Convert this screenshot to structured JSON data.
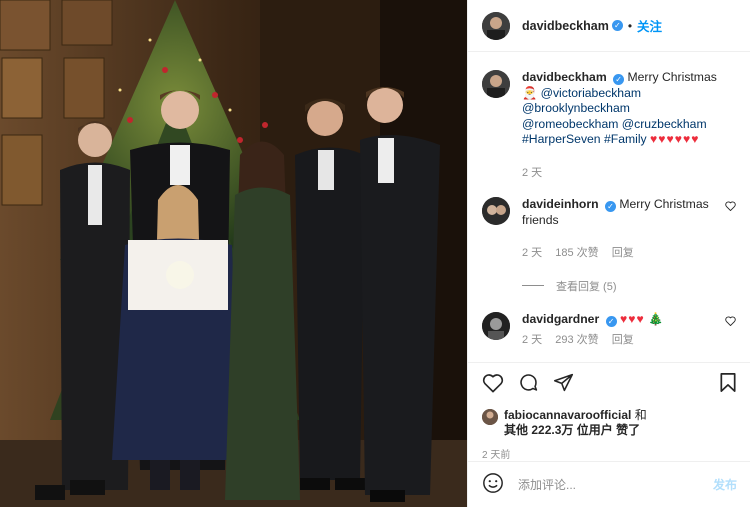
{
  "post": {
    "author": "davidbeckham",
    "follow_label": "关注",
    "dot": "•"
  },
  "caption": {
    "username": "davidbeckham",
    "text": "Merry Christmas 🎅",
    "mentions": [
      "@victoriabeckham",
      "@brooklynbeckham",
      "@romeobeckham",
      "@cruzbeckham"
    ],
    "hashtags": [
      "#HarperSeven",
      "#Family"
    ],
    "hearts": "♥♥♥♥♥♥",
    "time": "2 天"
  },
  "comments": [
    {
      "username": "davideinhorn",
      "text": "Merry Christmas friends",
      "time": "2 天",
      "likes": "185 次赞",
      "reply": "回复",
      "view_replies": "查看回复 (5)"
    },
    {
      "username": "davidgardner",
      "text_hearts": "♥♥♥",
      "text_tree": "🎄",
      "time": "2 天",
      "likes": "293 次赞",
      "reply": "回复"
    }
  ],
  "likes_line": {
    "user": "fabiocannavaroofficial",
    "and": "和",
    "others_prefix": "其他",
    "count": "222.3万",
    "suffix": "位用户 赞了"
  },
  "post_time": "2 天前",
  "add_comment": {
    "placeholder": "添加评论...",
    "post_label": "发布"
  },
  "icons": {
    "like": "heart-icon",
    "comment": "comment-icon",
    "share": "share-icon",
    "save": "bookmark-icon",
    "emoji": "emoji-icon",
    "verified": "verified-badge-icon"
  },
  "colors": {
    "link_blue": "#0095f6",
    "verified_blue": "#3897f0",
    "mention_blue": "#00376b",
    "heart_red": "#ed2d3c",
    "muted_gray": "#8e8e8e"
  }
}
